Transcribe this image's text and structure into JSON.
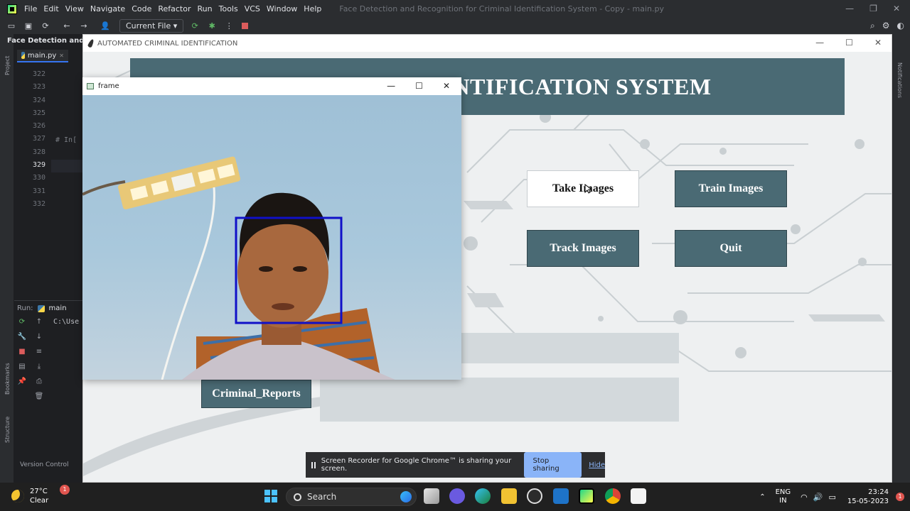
{
  "ide": {
    "menu": [
      "File",
      "Edit",
      "View",
      "Navigate",
      "Code",
      "Refactor",
      "Run",
      "Tools",
      "VCS",
      "Window",
      "Help"
    ],
    "window_title": "Face Detection and Recognition for Criminal Identification System - Copy - main.py",
    "run_config": "Current File",
    "project_title": "Face Detection and Re",
    "editor_tab": "main.py",
    "line_numbers": [
      "322",
      "323",
      "324",
      "325",
      "326",
      "327",
      "328",
      "329",
      "330",
      "331",
      "332"
    ],
    "current_line": "329",
    "code_snippet": "# In[",
    "run_label": "Run:",
    "run_tab": "main",
    "console_text": "C:\\Use",
    "status": "Version Control",
    "left_strip": [
      "Project",
      "Bookmarks",
      "Structure"
    ],
    "right_strip": "Notifications"
  },
  "app": {
    "window_title": "AUTOMATED CRIMINAL IDENTIFICATION",
    "banner_text": "L IDENTIFICATION SYSTEM",
    "buttons": {
      "take_images": "Take Images",
      "train_images": "Train Images",
      "track_images": "Track Images",
      "quit": "Quit",
      "criminal_reports": "Criminal_Reports"
    },
    "colors": {
      "accent": "#4a6a74",
      "background": "#eef0f1"
    }
  },
  "frame": {
    "title": "frame"
  },
  "share_bar": {
    "message": "Screen Recorder for Google Chrome™ is sharing your screen.",
    "stop_label": "Stop sharing",
    "hide_label": "Hide"
  },
  "taskbar": {
    "temperature": "27°C",
    "condition": "Clear",
    "weather_badge": "1",
    "search_label": "Search",
    "lang_top": "ENG",
    "lang_bottom": "IN",
    "time": "23:24",
    "date": "15-05-2023",
    "notification_count": "1"
  }
}
